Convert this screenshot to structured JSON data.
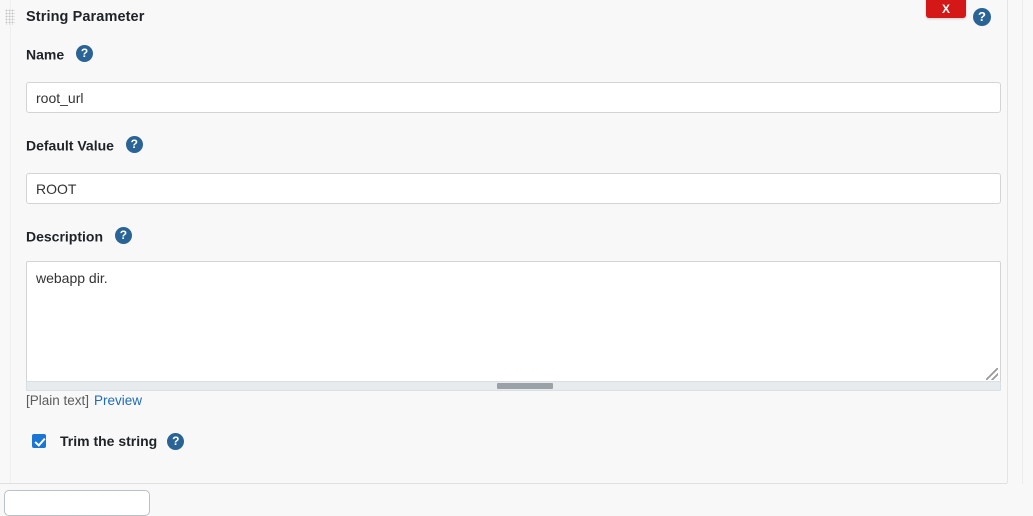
{
  "panel": {
    "title": "String Parameter",
    "drag_handle": "drag-handle",
    "delete_button_label": "X",
    "help_icon_label": "?"
  },
  "fields": {
    "name": {
      "label": "Name",
      "value": "root_url",
      "placeholder": "",
      "help": "?"
    },
    "default_value": {
      "label": "Default Value",
      "value": "ROOT",
      "placeholder": "",
      "help": "?"
    },
    "description": {
      "label": "Description",
      "value": "webapp dir.",
      "placeholder": "",
      "help": "?"
    }
  },
  "markup_line": {
    "format_tag": "[Plain text]",
    "preview_link": "Preview"
  },
  "trim": {
    "label": "Trim the string",
    "checked": true,
    "help": "?"
  },
  "bottom_button": {
    "label": ""
  },
  "colors": {
    "accent_blue": "#1e6bb8",
    "help_icon_blue": "#2a6496",
    "checkbox_blue": "#1a76d2",
    "delete_red": "#d41818",
    "page_background": "#f8f8f8",
    "input_border": "#d4d4d4"
  }
}
